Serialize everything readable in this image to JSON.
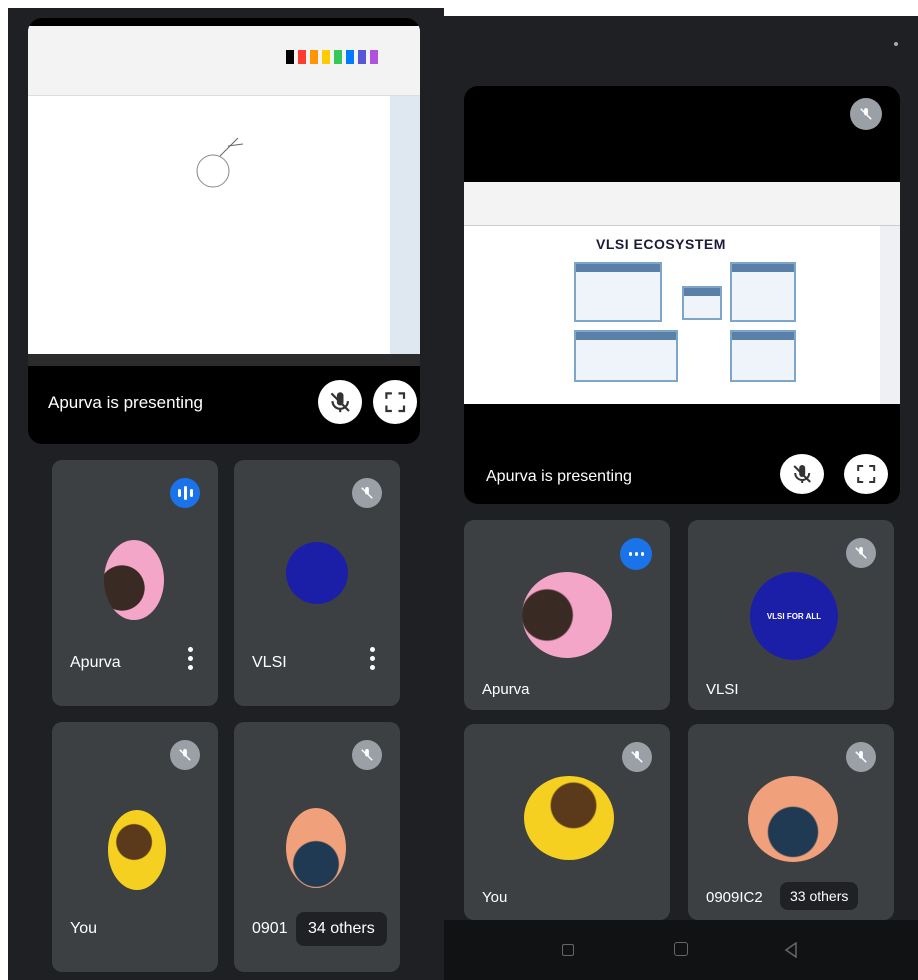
{
  "left": {
    "presenting_label": "Apurva is presenting",
    "tiles": [
      {
        "name": "Apurva"
      },
      {
        "name": "VLSI"
      },
      {
        "name": "You"
      },
      {
        "name": "0901"
      }
    ],
    "others_chip": "34 others"
  },
  "right": {
    "presenting_label": "Apurva is presenting",
    "slide_title": "VLSI ECOSYSTEM",
    "vlsi_logo_text": "VLSI FOR ALL",
    "tiles": [
      {
        "name": "Apurva"
      },
      {
        "name": "VLSI"
      },
      {
        "name": "You"
      },
      {
        "name": "0909IC2"
      }
    ],
    "others_chip": "33 others"
  },
  "colors": {
    "panel_bg": "#1f2023",
    "tile_bg": "#3c4043",
    "speaking_blue": "#1a73e8",
    "mute_grey": "#9aa0a6"
  },
  "icons": {
    "mute": "mic-off-icon",
    "fullscreen": "fullscreen-icon",
    "speaking": "audio-level-icon",
    "more": "more-vert-icon"
  }
}
